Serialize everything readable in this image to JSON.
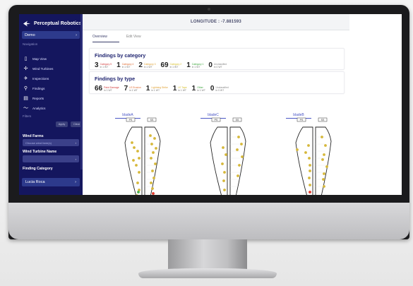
{
  "app": {
    "name": "Perceptual Robotics"
  },
  "sidebar": {
    "project": "Demo",
    "section_label": "Navigation",
    "items": [
      {
        "label": "Map View",
        "icon": "map-icon"
      },
      {
        "label": "Wind Turbines",
        "icon": "turbine-icon"
      },
      {
        "label": "Inspections",
        "icon": "drone-icon"
      },
      {
        "label": "Findings",
        "icon": "search-icon"
      },
      {
        "label": "Reports",
        "icon": "report-icon"
      },
      {
        "label": "Analytics",
        "icon": "chart-icon"
      }
    ],
    "filter_label": "Filters",
    "filter_buttons": [
      "Apply",
      "Clear"
    ],
    "wind_farms_label": "Wind Farms",
    "wind_farms_value": "Choose wind farm(s)",
    "turbine_name_label": "Wind Turbine Name",
    "turbine_name_value": "",
    "finding_category_label": "Finding Category",
    "user": "Lucia Roca"
  },
  "topbar": {
    "text": "LONGITUDE : -7.881593"
  },
  "tabs": [
    {
      "label": "Overview",
      "active": true
    },
    {
      "label": "Edit View",
      "active": false
    }
  ],
  "findings_by_category": {
    "title": "Findings by category",
    "stats": [
      {
        "count": "3",
        "label": "Category 5",
        "sub": "in 1 WT",
        "color": "#d23a3a"
      },
      {
        "count": "1",
        "label": "Category 4",
        "sub": "in 1 WT",
        "color": "#e06a30"
      },
      {
        "count": "2",
        "label": "Category 3",
        "sub": "in 1 WT",
        "color": "#e0a030"
      },
      {
        "count": "69",
        "label": "Category 2",
        "sub": "in 1 WT",
        "color": "#d8c02a"
      },
      {
        "count": "1",
        "label": "Category 1",
        "sub": "in 1 WT",
        "color": "#3aa53a"
      },
      {
        "count": "0",
        "label": "Unclassified",
        "sub": "in 0 WT",
        "color": "#888888"
      }
    ]
  },
  "findings_by_type": {
    "title": "Findings by type",
    "stats": [
      {
        "count": "66",
        "label": "Paint Damage",
        "sub": "in 1 WT",
        "color": "#d23a3a"
      },
      {
        "count": "7",
        "label": "LE Erosion",
        "sub": "in 1 WT",
        "color": "#e06a30"
      },
      {
        "count": "1",
        "label": "Lightning Strike",
        "sub": "in 1 WT",
        "color": "#e0a030"
      },
      {
        "count": "1",
        "label": "LE Tape",
        "sub": "in 1 WT",
        "color": "#d8c02a"
      },
      {
        "count": "1",
        "label": "Other",
        "sub": "in 1 WT",
        "color": "#3aa53a"
      },
      {
        "count": "0",
        "label": "Unclassified",
        "sub": "in 0 WT",
        "color": "#888888"
      }
    ]
  },
  "blades": [
    {
      "name": "bladeA",
      "side_labels": [
        "PS",
        "SS"
      ]
    },
    {
      "name": "bladeC",
      "side_labels": [
        "PS",
        "SS"
      ]
    },
    {
      "name": "bladeB",
      "side_labels": [
        "PS",
        "SS"
      ]
    }
  ]
}
